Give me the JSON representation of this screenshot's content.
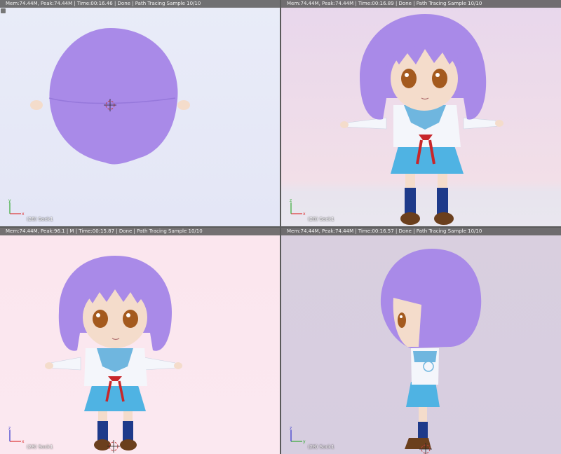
{
  "viewports": [
    {
      "id": "top",
      "header": "Mem:74.44M, Peak:74.44M | Time:00:16.46 | Done | Path Tracing Sample 10/10",
      "object_label": "(28) Sock1",
      "bg_top": "#e9ecf8",
      "bg_bottom": "#e4e6f6"
    },
    {
      "id": "perspective",
      "header": "Mem:74.44M, Peak:74.44M | Time:00:16.89 | Done | Path Tracing Sample 10/10",
      "object_label": "(28) Sock1",
      "bg_top": "#ead9ec",
      "bg_bottom": "#f3dfe8"
    },
    {
      "id": "front",
      "header": "Mem:74.44M, Peak:96.1 | M | Time:00:15.87 | Done | Path Tracing Sample 10/10",
      "object_label": "(28) Sock1",
      "bg_top": "#fbe6ee",
      "bg_bottom": "#fbe8f0"
    },
    {
      "id": "side",
      "header": "Mem:74.44M, Peak:74.44M | Time:00:16.57 | Done | Path Tracing Sample 10/10",
      "object_label": "(28) Sock1",
      "bg_top": "#d9cfdf",
      "bg_bottom": "#d7cee0"
    }
  ],
  "colors": {
    "hair": "#a98ae8",
    "hair_shadow": "#8a6cd2",
    "skin": "#f4dccb",
    "shirt": "#f4f6fb",
    "collar": "#6fb6df",
    "skirt": "#4fb3e3",
    "ribbon": "#c8262a",
    "socks": "#1e3a8a",
    "shoes": "#6b3f1d",
    "eyes": "#a45a1e"
  },
  "icons": [
    "axis-gizmo-icon",
    "cursor-3d-icon",
    "corner-widget-icon"
  ]
}
